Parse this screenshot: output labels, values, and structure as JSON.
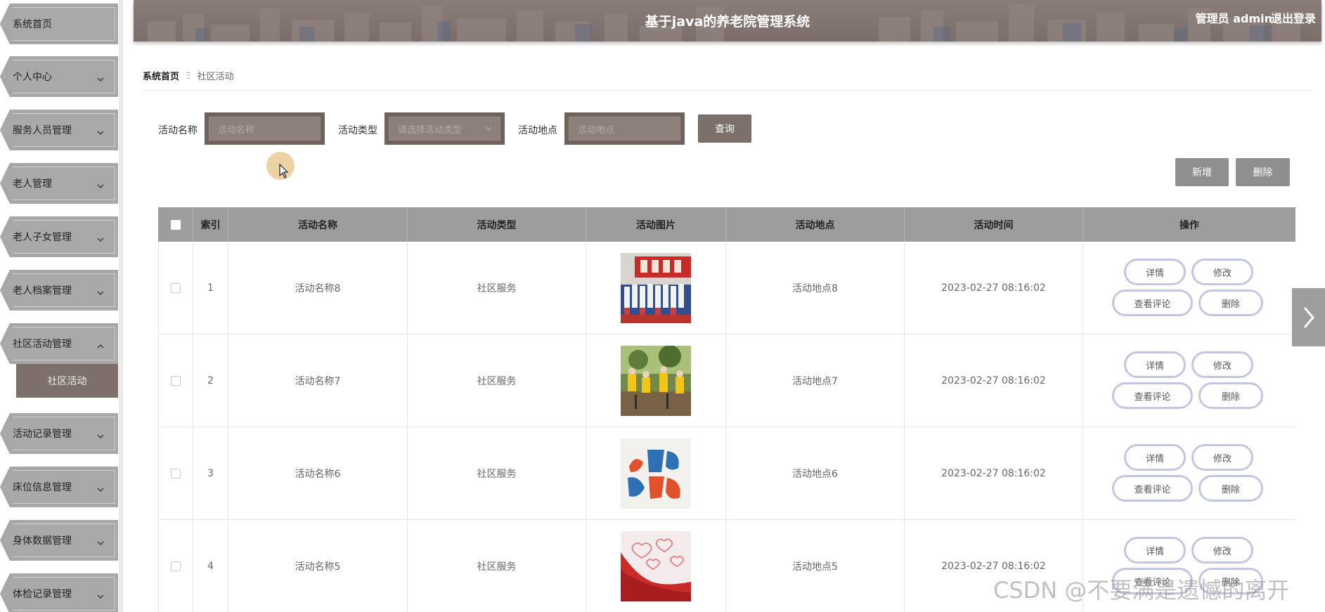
{
  "header": {
    "title": "基于java的养老院管理系统",
    "user": "管理员 admin",
    "logout": "退出登录"
  },
  "sidebar": {
    "items": [
      {
        "label": "系统首页",
        "chevron": ""
      },
      {
        "label": "个人中心",
        "chevron": "down"
      },
      {
        "label": "服务人员管理",
        "chevron": "down"
      },
      {
        "label": "老人管理",
        "chevron": "down"
      },
      {
        "label": "老人子女管理",
        "chevron": "down"
      },
      {
        "label": "老人档案管理",
        "chevron": "down"
      },
      {
        "label": "社区活动管理",
        "chevron": "up"
      },
      {
        "label": "活动记录管理",
        "chevron": "down"
      },
      {
        "label": "床位信息管理",
        "chevron": "down"
      },
      {
        "label": "身体数据管理",
        "chevron": "down"
      },
      {
        "label": "体检记录管理",
        "chevron": "down"
      }
    ],
    "active_sub": "社区活动"
  },
  "breadcrumb": {
    "home": "系统首页",
    "separator": "Ξ",
    "current": "社区活动"
  },
  "search": {
    "name_label": "活动名称",
    "name_placeholder": "活动名称",
    "type_label": "活动类型",
    "type_placeholder": "请选择活动类型",
    "place_label": "活动地点",
    "place_placeholder": "活动地点",
    "query_button": "查询"
  },
  "actions": {
    "add": "新增",
    "delete": "删除"
  },
  "table": {
    "columns": [
      "索引",
      "活动名称",
      "活动类型",
      "活动图片",
      "活动地点",
      "活动时间",
      "操作"
    ],
    "rows": [
      {
        "index": "1",
        "name": "活动名称8",
        "type": "社区服务",
        "image": "crowd-banner-photo",
        "place": "活动地点8",
        "time": "2023-02-27 08:16:02"
      },
      {
        "index": "2",
        "name": "活动名称7",
        "type": "社区服务",
        "image": "volunteers-planting-photo",
        "place": "活动地点7",
        "time": "2023-02-27 08:16:02"
      },
      {
        "index": "3",
        "name": "活动名称6",
        "type": "社区服务",
        "image": "charity-logo-image",
        "place": "活动地点6",
        "time": "2023-02-27 08:16:02"
      },
      {
        "index": "4",
        "name": "活动名称5",
        "type": "社区服务",
        "image": "hearts-ribbon-image",
        "place": "活动地点5",
        "time": "2023-02-27 08:16:02"
      }
    ],
    "row_buttons": {
      "detail": "详情",
      "edit": "修改",
      "comments": "查看评论",
      "delete": "删除"
    }
  },
  "watermark": "CSDN @不要满是遗憾的离开",
  "colors": {
    "header_bg": "#7e706c",
    "menu_bg": "#a7a7a7",
    "active_sub_bg": "#7d706a",
    "table_head_bg": "#9d9d9d",
    "op_border": "#c3c6e2"
  }
}
